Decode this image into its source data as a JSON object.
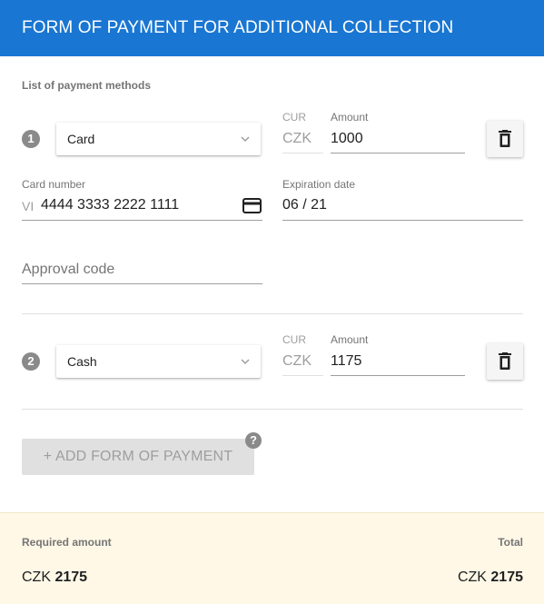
{
  "header": {
    "title": "FORM OF PAYMENT FOR ADDITIONAL COLLECTION"
  },
  "payment_methods": {
    "section_label": "List of payment methods",
    "items": [
      {
        "number": "1",
        "method": "Card",
        "currency_label": "CUR",
        "currency": "CZK",
        "amount_label": "Amount",
        "amount": "1000",
        "card_number_label": "Card number",
        "card_prefix": "VI",
        "card_number": "4444 3333 2222 1111",
        "expiration_label": "Expiration date",
        "expiration": "06 / 21",
        "approval_placeholder": "Approval code"
      },
      {
        "number": "2",
        "method": "Cash",
        "currency_label": "CUR",
        "currency": "CZK",
        "amount_label": "Amount",
        "amount": "1175"
      }
    ]
  },
  "add_button": {
    "label": "+ ADD FORM OF PAYMENT",
    "help": "?"
  },
  "footer": {
    "required_label": "Required amount",
    "required_currency": "CZK",
    "required_value": "2175",
    "total_label": "Total",
    "total_currency": "CZK",
    "total_value": "2175"
  },
  "icons": {
    "chevron": "chevron-down-icon",
    "delete": "trash-icon",
    "card": "credit-card-icon",
    "help": "help-icon"
  },
  "colors": {
    "header": "#1976d2",
    "footer_bg": "#fff8e7"
  }
}
